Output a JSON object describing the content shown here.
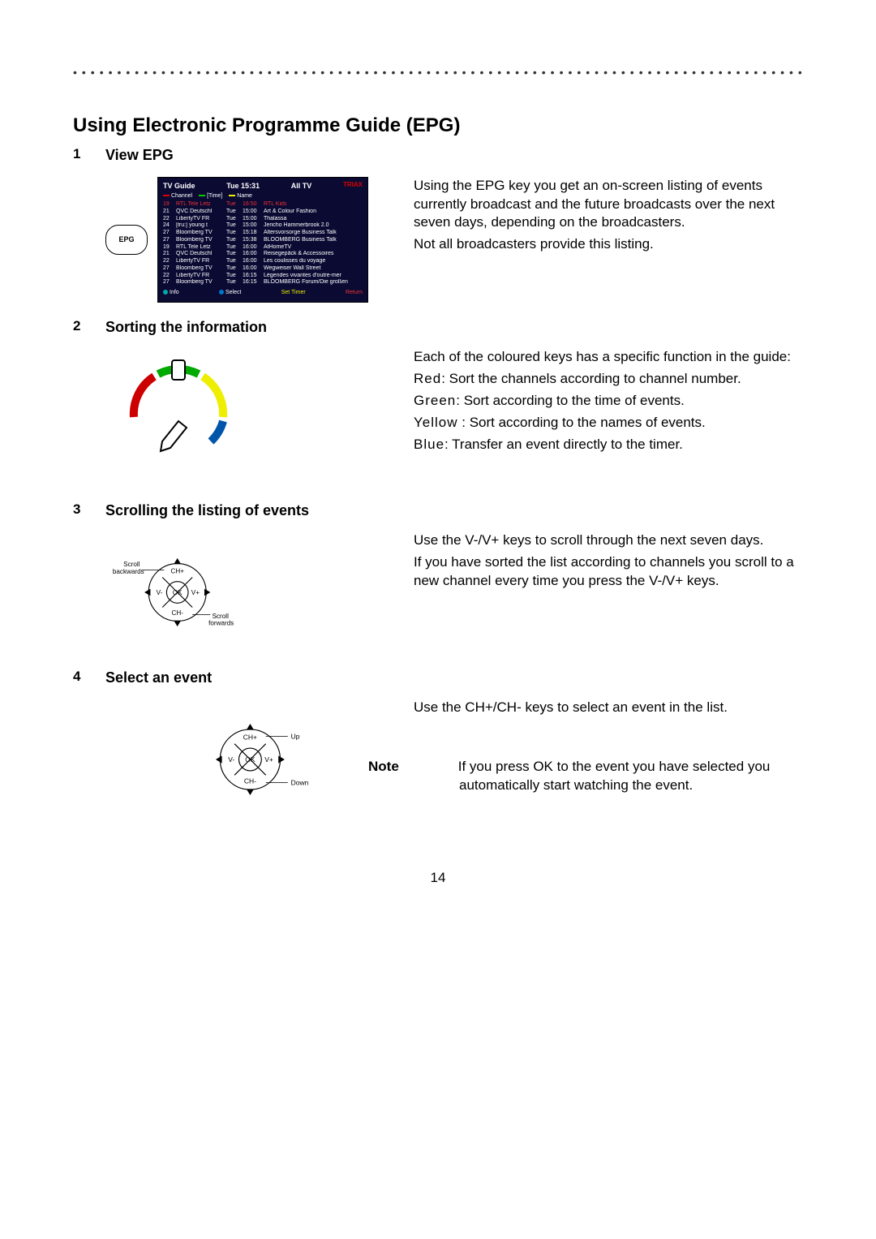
{
  "page_number": "14",
  "title": "Using Electronic Programme Guide (EPG)",
  "sections": {
    "s1": {
      "num": "1",
      "heading": "View EPG",
      "epg_key_label": "EPG",
      "tv_guide": {
        "title": "TV Guide",
        "time": "Tue 15:31",
        "scope": "All TV",
        "brand": "TRIAX",
        "sort_channel": "Channel",
        "sort_time": "[Time]",
        "sort_name": "Name",
        "rows": [
          {
            "n": "19",
            "ch": "RTL Tele Letz",
            "d": "Tue",
            "t": "16:50",
            "p": "RTL Kids",
            "sel": true
          },
          {
            "n": "21",
            "ch": "QVC Deutschl",
            "d": "Tue",
            "t": "15:00",
            "p": "Art & Colour Fashion"
          },
          {
            "n": "22",
            "ch": "LibertyTV FR",
            "d": "Tue",
            "t": "15:00",
            "p": "Thalassa"
          },
          {
            "n": "24",
            "ch": "[tru:] young t",
            "d": "Tue",
            "t": "15:00",
            "p": "Jericho Hammerbrook 2.0"
          },
          {
            "n": "27",
            "ch": "Bloomberg TV",
            "d": "Tue",
            "t": "15:18",
            "p": "Altersvorsorge Business Talk"
          },
          {
            "n": "27",
            "ch": "Bloomberg TV",
            "d": "Tue",
            "t": "15:38",
            "p": "BLOOMBERG Business Talk"
          },
          {
            "n": "19",
            "ch": "RTL Tele Letz",
            "d": "Tue",
            "t": "16:00",
            "p": "AtHomeTV"
          },
          {
            "n": "21",
            "ch": "QVC Deutschl",
            "d": "Tue",
            "t": "16:00",
            "p": "Reisegepäck & Accessoires"
          },
          {
            "n": "22",
            "ch": "LibertyTV FR",
            "d": "Tue",
            "t": "16:00",
            "p": "Les coulisses du voyage"
          },
          {
            "n": "27",
            "ch": "Bloomberg TV",
            "d": "Tue",
            "t": "16:00",
            "p": "Wegweiser Wall Street"
          },
          {
            "n": "22",
            "ch": "LibertyTV FR",
            "d": "Tue",
            "t": "16:15",
            "p": "Légendes vivantes d'outre-mer"
          },
          {
            "n": "27",
            "ch": "Bloomberg TV",
            "d": "Tue",
            "t": "16:15",
            "p": "BLOOMBERG Forum/Die großen"
          }
        ],
        "footer": {
          "info": "Info",
          "select": "Select",
          "timer": "Set Timer",
          "return": "Return"
        }
      },
      "para1": "Using the EPG key you get an on-screen listing of events currently broadcast and the future broadcasts over the next seven days, depending on the broadcasters.",
      "para2": "Not all broadcasters provide this listing."
    },
    "s2": {
      "num": "2",
      "heading": "Sorting the information",
      "intro": "Each of the coloured keys has a specific function in the guide:",
      "red_k": "Red",
      "red_t": ": Sort the channels according to channel number.",
      "green_k": "Green",
      "green_t": ": Sort according to the time of events.",
      "yellow_k": "Yellow",
      "yellow_t": " : Sort according to the names of events.",
      "blue_k": "Blue",
      "blue_t": ": Transfer an event directly to the timer."
    },
    "s3": {
      "num": "3",
      "heading": "Scrolling the listing of events",
      "labels": {
        "scroll_back": "Scroll\nbackwards",
        "scroll_fwd": "Scroll\nforwards",
        "chp": "CH+",
        "chm": "CH-",
        "vm": "V-",
        "vp": "V+",
        "ok": "OK"
      },
      "para1": "Use the V-/V+ keys to scroll through the next seven days.",
      "para2": "If you have sorted the list according to channels you scroll to a new channel every time you press the V-/V+ keys."
    },
    "s4": {
      "num": "4",
      "heading": "Select an event",
      "labels": {
        "up": "Up",
        "down": "Down",
        "chp": "CH+",
        "chm": "CH-",
        "vm": "V-",
        "vp": "V+",
        "ok": "OK"
      },
      "para1": "Use the CH+/CH- keys to select an event in the list.",
      "note_label": "Note",
      "note_text": "If you press OK to the event you have selected you automatically start watching the event."
    }
  }
}
